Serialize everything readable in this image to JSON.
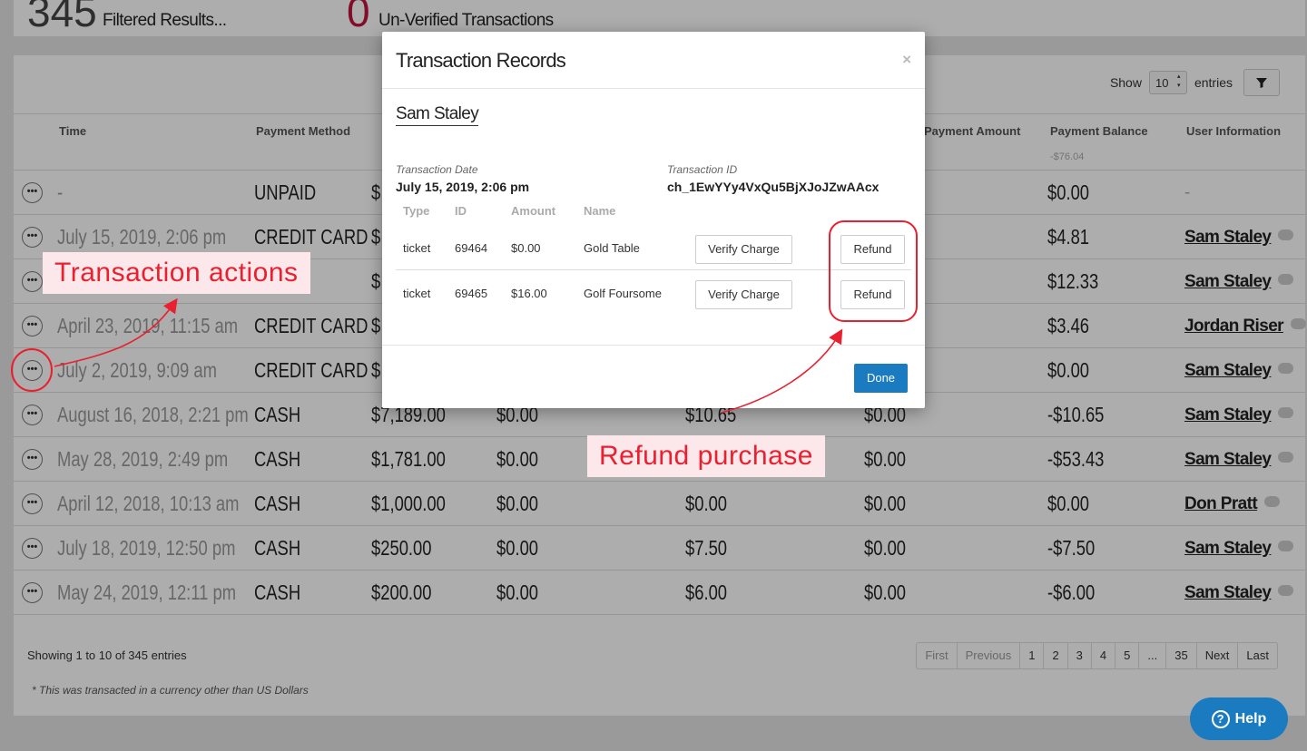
{
  "stats": {
    "filtered_count": "345",
    "filtered_label": "Filtered Results...",
    "unverified_count": "0",
    "unverified_label": "Un-Verified Transactions"
  },
  "table_controls": {
    "show_label": "Show",
    "entries_value": "10",
    "entries_label": "entries",
    "filter_icon": "filter-icon"
  },
  "columns": {
    "time": "Time",
    "payment_method": "Payment Method",
    "payment_amount": "Payment Amount",
    "payment_balance": "Payment Balance",
    "user_information": "User Information",
    "balance_total": "-$76.04"
  },
  "rows": [
    {
      "time": "-",
      "method": "UNPAID",
      "c3": "$",
      "c4": "",
      "c5": "",
      "c6": "",
      "balance": "$0.00",
      "user": "-",
      "has_chat": false
    },
    {
      "time": "July 15, 2019, 2:06 pm",
      "method": "CREDIT CARD",
      "c3": "$",
      "c4": "",
      "c5": "",
      "c6": "",
      "balance": "$4.81",
      "user": "Sam Staley",
      "has_chat": true
    },
    {
      "time": "",
      "method": "CARD",
      "c3": "$",
      "c4": "",
      "c5": "",
      "c6": "",
      "balance": "$12.33",
      "user": "Sam Staley",
      "has_chat": true
    },
    {
      "time": "April 23, 2019, 11:15 am",
      "method": "CREDIT CARD",
      "c3": "$",
      "c4": "",
      "c5": "",
      "c6": "",
      "balance": "$3.46",
      "user": "Jordan Riser",
      "has_chat": true
    },
    {
      "time": "July 2, 2019, 9:09 am",
      "method": "CREDIT CARD",
      "c3": "$",
      "c4": "",
      "c5": "",
      "c6": "",
      "balance": "$0.00",
      "user": "Sam Staley",
      "has_chat": true
    },
    {
      "time": "August 16, 2018, 2:21 pm",
      "method": "CASH",
      "c3": "$7,189.00",
      "c4": "$0.00",
      "c5": "$10.65",
      "c6": "$0.00",
      "balance": "-$10.65",
      "user": "Sam Staley",
      "has_chat": true
    },
    {
      "time": "May 28, 2019, 2:49 pm",
      "method": "CASH",
      "c3": "$1,781.00",
      "c4": "$0.00",
      "c5": "",
      "c6": "$0.00",
      "balance": "-$53.43",
      "user": "Sam Staley",
      "has_chat": true
    },
    {
      "time": "April 12, 2018, 10:13 am",
      "method": "CASH",
      "c3": "$1,000.00",
      "c4": "$0.00",
      "c5": "$0.00",
      "c6": "$0.00",
      "balance": "$0.00",
      "user": "Don Pratt",
      "has_chat": true
    },
    {
      "time": "July 18, 2019, 12:50 pm",
      "method": "CASH",
      "c3": "$250.00",
      "c4": "$0.00",
      "c5": "$7.50",
      "c6": "$0.00",
      "balance": "-$7.50",
      "user": "Sam Staley",
      "has_chat": true
    },
    {
      "time": "May 24, 2019, 12:11 pm",
      "method": "CASH",
      "c3": "$200.00",
      "c4": "$0.00",
      "c5": "$6.00",
      "c6": "$0.00",
      "balance": "-$6.00",
      "user": "Sam Staley",
      "has_chat": true
    }
  ],
  "footer": {
    "showing": "Showing 1 to 10 of 345 entries",
    "footnote": "* This was transacted in a currency other than US Dollars",
    "pagination": [
      "First",
      "Previous",
      "1",
      "2",
      "3",
      "4",
      "5",
      "...",
      "35",
      "Next",
      "Last"
    ]
  },
  "modal": {
    "title": "Transaction Records",
    "close": "×",
    "customer": "Sam Staley",
    "date_label": "Transaction Date",
    "date_value": "July 15, 2019, 2:06 pm",
    "id_label": "Transaction ID",
    "id_value": "ch_1EwYYy4VxQu5BjXJoJZwAAcx",
    "headers": {
      "type": "Type",
      "id": "ID",
      "amount": "Amount",
      "name": "Name"
    },
    "items": [
      {
        "type": "ticket",
        "id": "69464",
        "amount": "$0.00",
        "name": "Gold Table",
        "verify": "Verify Charge",
        "refund": "Refund"
      },
      {
        "type": "ticket",
        "id": "69465",
        "amount": "$16.00",
        "name": "Golf Foursome",
        "verify": "Verify Charge",
        "refund": "Refund"
      }
    ],
    "done": "Done"
  },
  "annotations": {
    "actions_label": "Transaction actions",
    "refund_label": "Refund purchase",
    "color": "#e8202f"
  },
  "help": {
    "label": "Help",
    "icon": "?"
  }
}
